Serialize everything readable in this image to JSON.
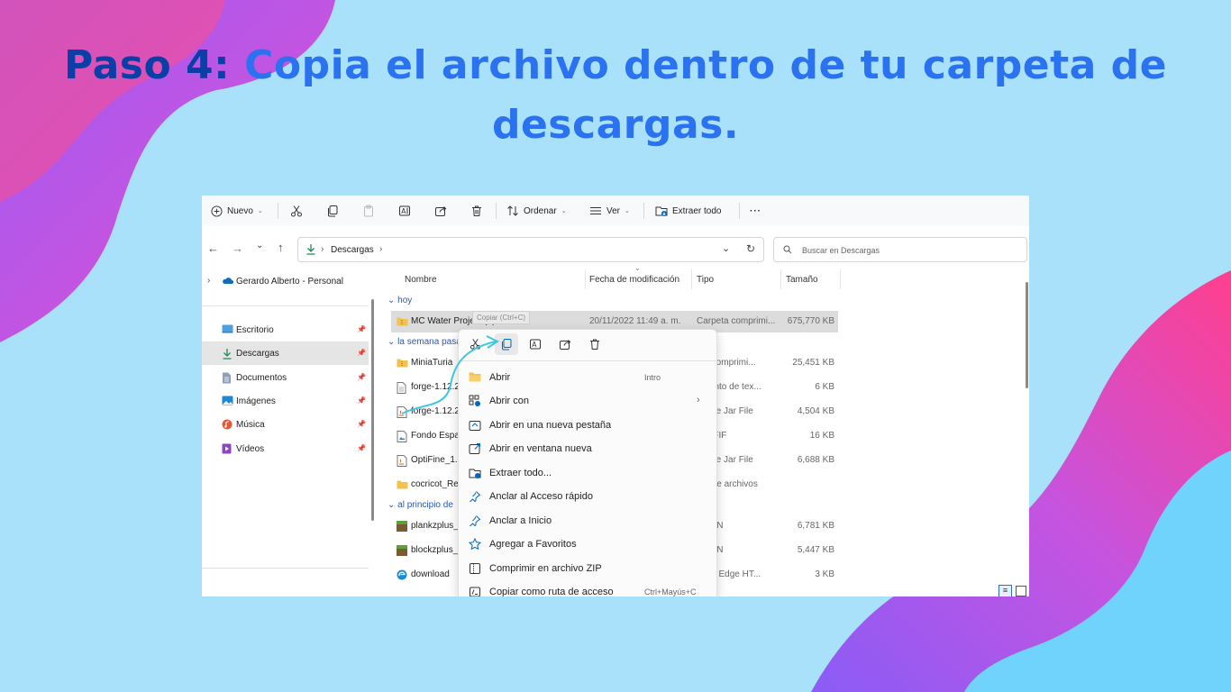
{
  "heading": {
    "prefix": "Paso 4:",
    "line1": "Copia el archivo dentro de tu carpeta de",
    "line2": "descargas."
  },
  "toolbar": {
    "new_label": "Nuevo",
    "sort_label": "Ordenar",
    "view_label": "Ver",
    "extract_label": "Extraer todo",
    "more_label": "···"
  },
  "address": {
    "path_label": "Descargas",
    "search_placeholder": "Buscar en Descargas"
  },
  "sidebar": {
    "onedrive_label": "Gerardo Alberto - Personal",
    "items": [
      {
        "label": "Escritorio"
      },
      {
        "label": "Descargas"
      },
      {
        "label": "Documentos"
      },
      {
        "label": "Imágenes"
      },
      {
        "label": "Música"
      },
      {
        "label": "Vídeos"
      }
    ]
  },
  "columns": {
    "name": "Nombre",
    "date": "Fecha de modificación",
    "type": "Tipo",
    "size": "Tamaño"
  },
  "groups": {
    "today": "hoy",
    "last_week": "la semana pasa",
    "earlier": "al principio de"
  },
  "files": [
    {
      "name": "MC Water Project (1)",
      "date": "20/11/2022 11:49 a. m.",
      "type": "Carpeta comprimi...",
      "size": "675,770 KB"
    },
    {
      "name": "MiniaTuria",
      "date": "",
      "type": "eta comprimi...",
      "size": "25,451 KB"
    },
    {
      "name": "forge-1.12.2",
      "date": "",
      "type": "amento de tex...",
      "size": "6 KB"
    },
    {
      "name": "forge-1.12.2",
      "date": "",
      "type": "utable Jar File",
      "size": "4,504 KB"
    },
    {
      "name": "Fondo Espa",
      "date": "",
      "type": "vo JFIF",
      "size": "16 KB"
    },
    {
      "name": "OptiFine_1.1",
      "date": "",
      "type": "utable Jar File",
      "size": "6,688 KB"
    },
    {
      "name": "cocricot_Re",
      "date": "",
      "type": "eta de archivos",
      "size": ""
    },
    {
      "name": "plankzplus_",
      "date": "",
      "type": "DDON",
      "size": "6,781 KB"
    },
    {
      "name": "blockzplus_",
      "date": "",
      "type": "DDON",
      "size": "5,447 KB"
    },
    {
      "name": "download",
      "date": "",
      "type": "osoft Edge HT...",
      "size": "3 KB"
    }
  ],
  "tooltip": "Copiar (Ctrl+C)",
  "context_menu": {
    "items": [
      {
        "label": "Abrir",
        "shortcut": "Intro"
      },
      {
        "label": "Abrir con",
        "shortcut": ""
      },
      {
        "label": "Abrir en una nueva pestaña",
        "shortcut": ""
      },
      {
        "label": "Abrir en ventana nueva",
        "shortcut": ""
      },
      {
        "label": "Extraer todo...",
        "shortcut": ""
      },
      {
        "label": "Anclar al Acceso rápido",
        "shortcut": ""
      },
      {
        "label": "Anclar a Inicio",
        "shortcut": ""
      },
      {
        "label": "Agregar a Favoritos",
        "shortcut": ""
      },
      {
        "label": "Comprimir en archivo ZIP",
        "shortcut": ""
      },
      {
        "label": "Copiar como ruta de acceso",
        "shortcut": "Ctrl+Mayús+C"
      }
    ]
  },
  "colors": {
    "background": "#a9e1fb",
    "title_blue": "#2a72f0",
    "title_dark": "#0a3fa8",
    "accent": "#0067c0"
  }
}
